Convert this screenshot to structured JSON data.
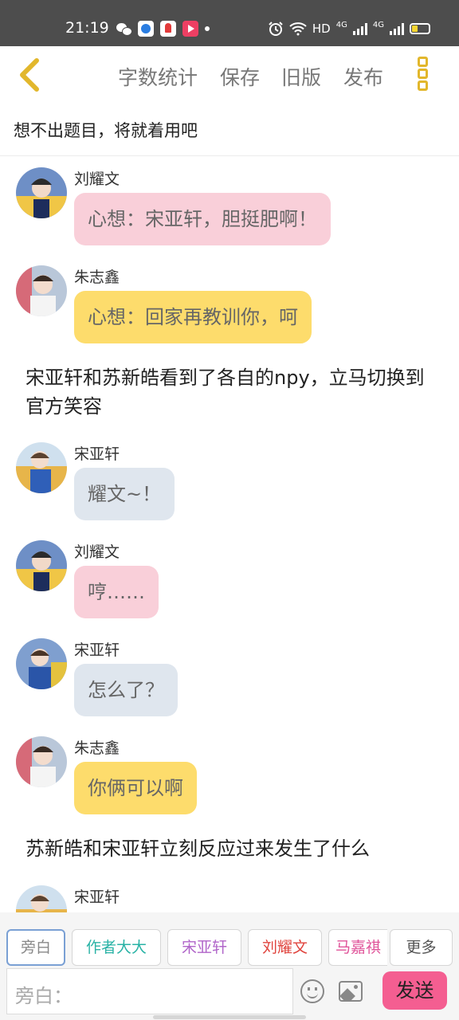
{
  "status_bar": {
    "time": "21:19",
    "network_label": "HD",
    "signal_1": "4G",
    "signal_2": "4G",
    "icons": [
      "wechat-icon",
      "browser-icon",
      "map-icon",
      "video-app-icon",
      "alarm-icon",
      "wifi-icon",
      "battery-icon"
    ]
  },
  "toolbar": {
    "word_count": "字数统计",
    "save": "保存",
    "old_version": "旧版",
    "publish": "发布",
    "accent_color": "#e2b72c"
  },
  "story": {
    "title": "想不出题目，将就着用吧"
  },
  "messages": [
    {
      "kind": "dialog",
      "sender": "刘耀文",
      "text": "心想：宋亚轩，胆挺肥啊！",
      "color": "#f9cfd9"
    },
    {
      "kind": "dialog",
      "sender": "朱志鑫",
      "text": "心想：回家再教训你，呵",
      "color": "#fddc6c"
    },
    {
      "kind": "narration",
      "text": "宋亚轩和苏新皓看到了各自的npy，立马切换到官方笑容"
    },
    {
      "kind": "dialog",
      "sender": "宋亚轩",
      "text": "耀文~！",
      "color": "#dfe6ee"
    },
    {
      "kind": "dialog",
      "sender": "刘耀文",
      "text": "哼……",
      "color": "#f9cfd9"
    },
    {
      "kind": "dialog",
      "sender": "宋亚轩",
      "text": "怎么了？",
      "color": "#dfe6ee"
    },
    {
      "kind": "dialog",
      "sender": "朱志鑫",
      "text": "你俩可以啊",
      "color": "#fddc6c"
    },
    {
      "kind": "narration",
      "text": "苏新皓和宋亚轩立刻反应过来发生了什么"
    },
    {
      "kind": "dialog",
      "sender": "宋亚轩",
      "text": ""
    }
  ],
  "roles": [
    {
      "label": "旁白",
      "color": "#888888",
      "selected": true
    },
    {
      "label": "作者大大",
      "color": "#2ab3a6"
    },
    {
      "label": "宋亚轩",
      "color": "#b065c9"
    },
    {
      "label": "刘耀文",
      "color": "#e0443e"
    },
    {
      "label": "马嘉祺",
      "color": "#e0549a"
    },
    {
      "label": "更多",
      "color": "#555555"
    }
  ],
  "input": {
    "placeholder": "旁白：",
    "send": "发送",
    "send_color": "#f45e91"
  }
}
